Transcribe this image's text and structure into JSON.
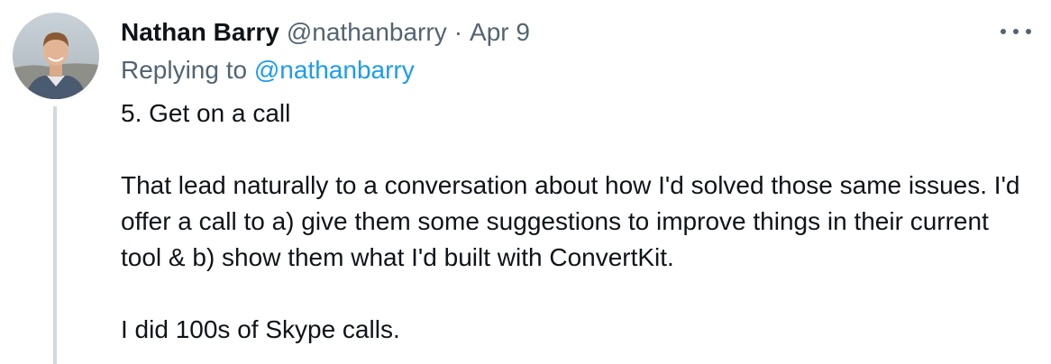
{
  "tweet": {
    "author_name": "Nathan Barry",
    "author_handle": "@nathanbarry",
    "separator": "·",
    "date": "Apr 9",
    "replying_prefix": "Replying to",
    "replying_handle": "@nathanbarry",
    "paragraphs": [
      "5. Get on a call",
      "That lead naturally to a  conversation about how I'd solved those same issues. I'd offer a call to a) give them some suggestions to improve things in their current tool  & b) show them what I'd built with ConvertKit.",
      "I did 100s of Skype calls."
    ],
    "more_icon": "more-horizontal-icon"
  },
  "colors": {
    "text": "#0f1419",
    "secondary": "#536471",
    "link": "#1d9bf0",
    "thread_line": "#cfd9de"
  }
}
